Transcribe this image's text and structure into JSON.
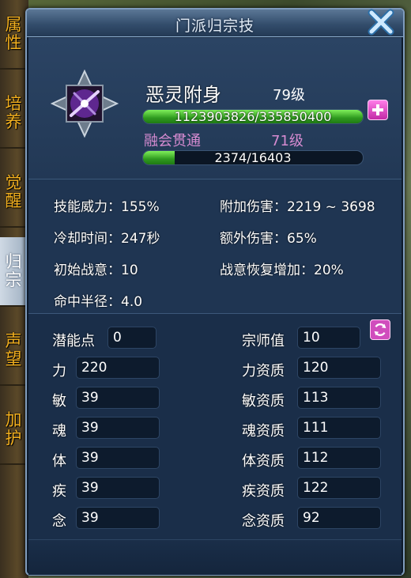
{
  "tabs": [
    {
      "label": "属\n性"
    },
    {
      "label": "培\n养"
    },
    {
      "label": "觉\n醒"
    },
    {
      "label": "归\n宗",
      "active": true
    },
    {
      "label": "声\n望"
    },
    {
      "label": "加\n护"
    }
  ],
  "window": {
    "title": "门派归宗技"
  },
  "skill": {
    "name": "恶灵附身",
    "level": "79级",
    "exp_text": "1123903826/335850400",
    "exp_fraction": 1.0,
    "fusion_name": "融会贯通",
    "fusion_level": "71级",
    "fusion_text": "2374/16403",
    "fusion_fraction": 0.145
  },
  "stats": {
    "skill_power": "技能威力：155%",
    "extra_damage_add": "附加伤害：2219 ~ 3698",
    "cooldown": "冷却时间：247秒",
    "bonus_damage": "额外伤害：65%",
    "init_battle_will": "初始战意：10",
    "will_recovery": "战意恢复增加：20%",
    "hit_radius": "命中半径：4.0"
  },
  "attributes": {
    "potential_label": "潜能点",
    "potential_value": "0",
    "master_label": "宗师值",
    "master_value": "10",
    "left": [
      {
        "label": "力",
        "value": "220"
      },
      {
        "label": "敏",
        "value": "39"
      },
      {
        "label": "魂",
        "value": "39"
      },
      {
        "label": "体",
        "value": "39"
      },
      {
        "label": "疾",
        "value": "39"
      },
      {
        "label": "念",
        "value": "39"
      }
    ],
    "right": [
      {
        "label": "力资质",
        "value": "120"
      },
      {
        "label": "敏资质",
        "value": "113"
      },
      {
        "label": "魂资质",
        "value": "111"
      },
      {
        "label": "体资质",
        "value": "112"
      },
      {
        "label": "疾资质",
        "value": "122"
      },
      {
        "label": "念资质",
        "value": "92"
      }
    ]
  },
  "colors": {
    "accent_orange": "#f3b01f",
    "exp_green": "#4fd23a",
    "fusion_pink": "#d58bd0",
    "panel_blue": "#1d3049"
  },
  "icons": [
    "close-icon",
    "skill-icon",
    "add-icon",
    "reset-icon"
  ]
}
